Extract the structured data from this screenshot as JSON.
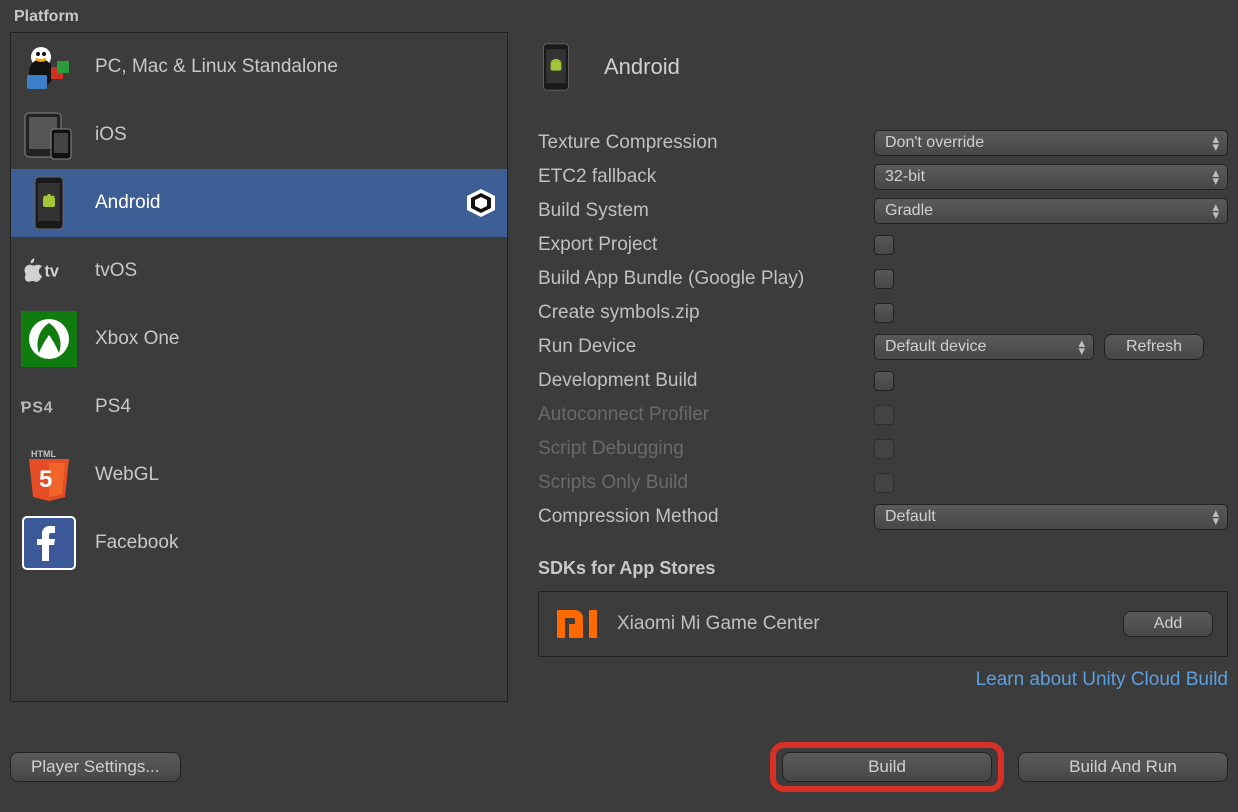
{
  "header": {
    "title": "Platform"
  },
  "platforms": [
    {
      "label": "PC, Mac & Linux Standalone"
    },
    {
      "label": "iOS"
    },
    {
      "label": "Android",
      "selected": true
    },
    {
      "label": "tvOS"
    },
    {
      "label": "Xbox One"
    },
    {
      "label": "PS4"
    },
    {
      "label": "WebGL"
    },
    {
      "label": "Facebook"
    }
  ],
  "details": {
    "title": "Android",
    "rows": {
      "texture_compression": {
        "label": "Texture Compression",
        "value": "Don't override"
      },
      "etc2_fallback": {
        "label": "ETC2 fallback",
        "value": "32-bit"
      },
      "build_system": {
        "label": "Build System",
        "value": "Gradle"
      },
      "export_project": {
        "label": "Export Project"
      },
      "build_app_bundle": {
        "label": "Build App Bundle (Google Play)"
      },
      "create_symbols": {
        "label": "Create symbols.zip"
      },
      "run_device": {
        "label": "Run Device",
        "value": "Default device",
        "refresh": "Refresh"
      },
      "development_build": {
        "label": "Development Build"
      },
      "autoconnect_profiler": {
        "label": "Autoconnect Profiler"
      },
      "script_debugging": {
        "label": "Script Debugging"
      },
      "scripts_only_build": {
        "label": "Scripts Only Build"
      },
      "compression_method": {
        "label": "Compression Method",
        "value": "Default"
      }
    },
    "sdk_header": "SDKs for App Stores",
    "sdk_item": {
      "label": "Xiaomi Mi Game Center",
      "button": "Add"
    },
    "cloud_link": "Learn about Unity Cloud Build"
  },
  "buttons": {
    "player_settings": "Player Settings...",
    "build": "Build",
    "build_and_run": "Build And Run"
  }
}
